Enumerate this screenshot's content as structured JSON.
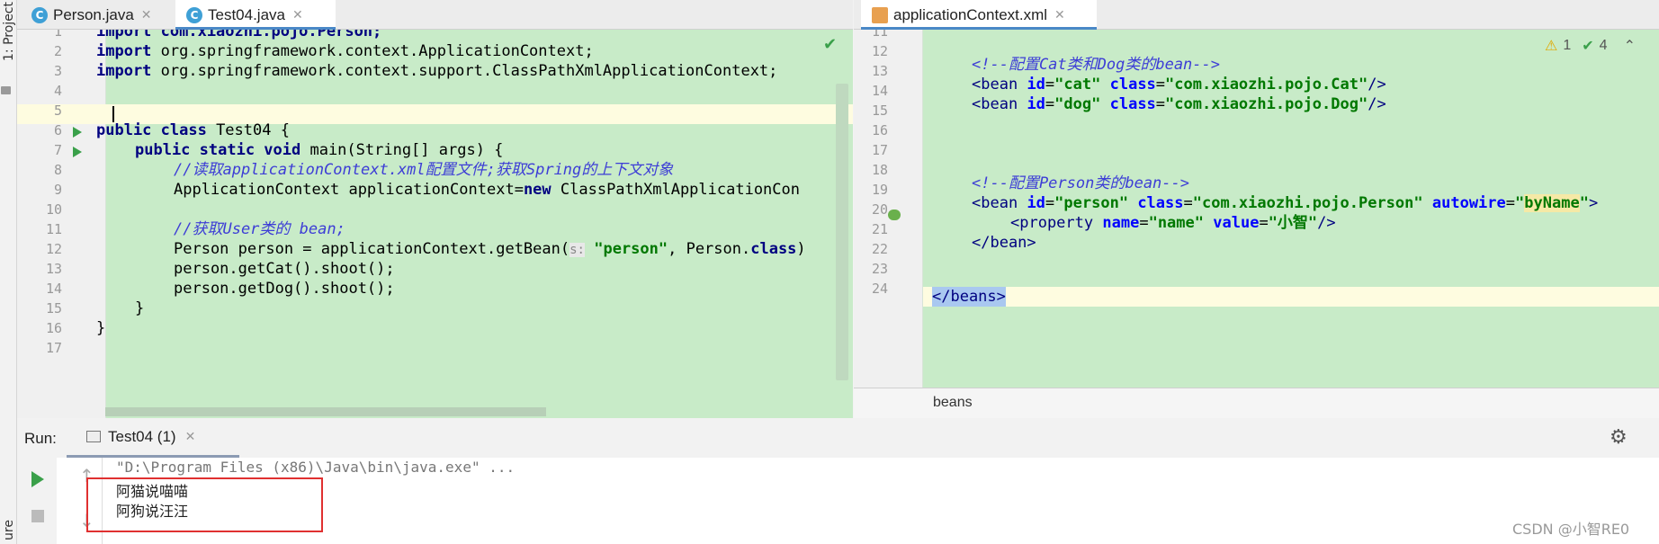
{
  "sidebar": {
    "project_label": "1: Project",
    "bottom_label": "ure"
  },
  "editor_left": {
    "tabs": [
      {
        "label": "Person.java",
        "icon": "class-icon"
      },
      {
        "label": "Test04.java",
        "icon": "class-run-icon",
        "active": true
      }
    ],
    "line_numbers": [
      "1",
      "2",
      "3",
      "4",
      "5",
      "6",
      "7",
      "8",
      "9",
      "10",
      "11",
      "12",
      "13",
      "14",
      "15",
      "16",
      "17"
    ],
    "lines": {
      "l1": "import com.xiaozhi.pojo.Person;",
      "l2_kw": "import",
      "l2": " org.springframework.context.ApplicationContext;",
      "l3_kw": "import",
      "l3": " org.springframework.context.support.ClassPathXmlApplicationContext;",
      "l6_kw": "public class",
      "l6": " Test04 {",
      "l7_kw": "public static void",
      "l7": " main(String[] args) {",
      "l8": "//读取applicationContext.xml配置文件;获取Spring的上下文对象",
      "l9a": "ApplicationContext applicationContext=",
      "l9_kw": "new",
      "l9b": " ClassPathXmlApplicationCon",
      "l11": "//获取User类的 bean;",
      "l12a": "Person person = applicationContext.getBean(",
      "l12_hint": "s:",
      "l12_str": "\"person\"",
      "l12b": ", Person.",
      "l12_kw": "class",
      "l12c": ")",
      "l13": "person.getCat().shoot();",
      "l14": "person.getDog().shoot();",
      "l15": "}",
      "l16": "}"
    }
  },
  "editor_right": {
    "tabs": [
      {
        "label": "applicationContext.xml",
        "icon": "xml-file-icon",
        "active": true
      }
    ],
    "line_numbers": [
      "11",
      "12",
      "13",
      "14",
      "15",
      "16",
      "17",
      "18",
      "19",
      "20",
      "21",
      "22",
      "23",
      "24"
    ],
    "inspections": {
      "warnings": "1",
      "weak_warnings": "4"
    },
    "lines": {
      "l13": "<!--配置Cat类和Dog类的bean-->",
      "l14_tag": "<bean",
      "l14_a1": "id",
      "l14_v1": "\"cat\"",
      "l14_a2": "class",
      "l14_v2": "\"com.xiaozhi.pojo.Cat\"",
      "l14_end": "/>",
      "l15_tag": "<bean",
      "l15_a1": "id",
      "l15_v1": "\"dog\"",
      "l15_a2": "class",
      "l15_v2": "\"com.xiaozhi.pojo.Dog\"",
      "l15_end": "/>",
      "l19": "<!--配置Person类的bean-->",
      "l20_tag": "<bean",
      "l20_a1": "id",
      "l20_v1": "\"person\"",
      "l20_a2": "class",
      "l20_v2": "\"com.xiaozhi.pojo.Person\"",
      "l20_a3": "autowire",
      "l20_v3a": "\"",
      "l20_v3": "byName",
      "l20_v3b": "\"",
      "l20_end": ">",
      "l21_tag": "<property",
      "l21_a1": "name",
      "l21_v1": "\"name\"",
      "l21_a2": "value",
      "l21_v2": "\"小智\"",
      "l21_end": "/>",
      "l22": "</bean>",
      "l24": "</beans>"
    },
    "breadcrumb": "beans"
  },
  "run_panel": {
    "label": "Run:",
    "tab": "Test04 (1)",
    "command": "\"D:\\Program Files (x86)\\Java\\bin\\java.exe\" ...",
    "output": [
      "阿猫说喵喵",
      "阿狗说汪汪"
    ],
    "watermark": "CSDN @小智RE0"
  },
  "colors": {
    "editor_bg": "#c8ebc8",
    "highlight_box": "#e03030",
    "active_tab_underline": "#4a88c7"
  }
}
